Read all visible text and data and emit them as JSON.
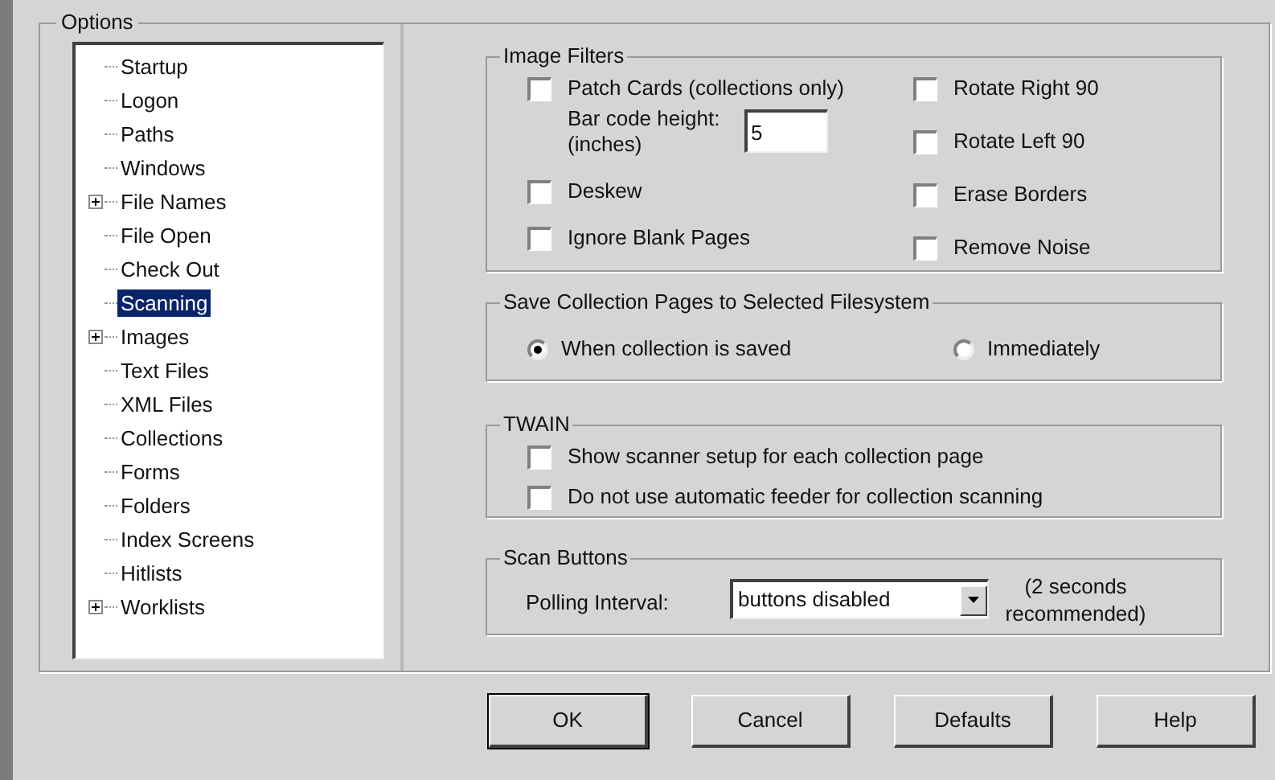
{
  "options": {
    "title": "Options",
    "tree": [
      {
        "label": "Startup",
        "kind": "leaf",
        "selected": false
      },
      {
        "label": "Logon",
        "kind": "leaf",
        "selected": false
      },
      {
        "label": "Paths",
        "kind": "leaf",
        "selected": false
      },
      {
        "label": "Windows",
        "kind": "leaf",
        "selected": false
      },
      {
        "label": "File Names",
        "kind": "node",
        "selected": false
      },
      {
        "label": "File Open",
        "kind": "leaf",
        "selected": false
      },
      {
        "label": "Check Out",
        "kind": "leaf",
        "selected": false
      },
      {
        "label": "Scanning",
        "kind": "leaf",
        "selected": true
      },
      {
        "label": "Images",
        "kind": "node",
        "selected": false
      },
      {
        "label": "Text Files",
        "kind": "leaf",
        "selected": false
      },
      {
        "label": "XML Files",
        "kind": "leaf",
        "selected": false
      },
      {
        "label": "Collections",
        "kind": "leaf",
        "selected": false
      },
      {
        "label": "Forms",
        "kind": "leaf",
        "selected": false
      },
      {
        "label": "Folders",
        "kind": "leaf",
        "selected": false
      },
      {
        "label": "Index Screens",
        "kind": "leaf",
        "selected": false
      },
      {
        "label": "Hitlists",
        "kind": "leaf",
        "selected": false
      },
      {
        "label": "Worklists",
        "kind": "node",
        "selected": false
      }
    ]
  },
  "image_filters": {
    "title": "Image Filters",
    "patch_cards": {
      "label": "Patch Cards (collections only)",
      "checked": false
    },
    "bar_code": {
      "label": "Bar code height: (inches)",
      "value": "5"
    },
    "left": [
      {
        "label": "Deskew",
        "checked": false
      },
      {
        "label": "Ignore Blank Pages",
        "checked": false
      }
    ],
    "right": [
      {
        "label": "Rotate Right 90",
        "checked": false
      },
      {
        "label": "Rotate Left 90",
        "checked": false
      },
      {
        "label": "Erase Borders",
        "checked": false
      },
      {
        "label": "Remove Noise",
        "checked": false
      }
    ]
  },
  "save_collection": {
    "title": "Save Collection Pages to Selected Filesystem",
    "options": [
      {
        "label": "When collection is saved",
        "selected": true
      },
      {
        "label": "Immediately",
        "selected": false
      }
    ]
  },
  "twain": {
    "title": "TWAIN",
    "options": [
      {
        "label": "Show scanner setup for each collection page",
        "checked": false
      },
      {
        "label": "Do not use automatic feeder for collection scanning",
        "checked": false
      }
    ]
  },
  "scan_buttons": {
    "title": "Scan Buttons",
    "label": "Polling Interval:",
    "value": "buttons disabled",
    "note": "(2 seconds recommended)"
  },
  "buttons": [
    {
      "label": "OK",
      "default": true
    },
    {
      "label": "Cancel",
      "default": false
    },
    {
      "label": "Defaults",
      "default": false
    },
    {
      "label": "Help",
      "default": false
    }
  ]
}
